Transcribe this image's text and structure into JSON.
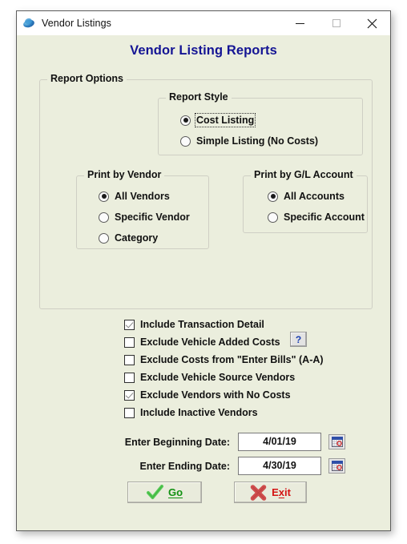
{
  "window": {
    "title": "Vendor Listings",
    "icon": "app-disc-icon",
    "controls": {
      "minimize": "minimize-icon",
      "maximize": "maximize-icon",
      "close": "close-icon"
    }
  },
  "heading": "Vendor Listing Reports",
  "colors": {
    "form_background": "#EBEEDD",
    "heading_text": "#141494",
    "go_text": "#129112",
    "exit_text": "#D41414",
    "group_border": "#CFCFC4"
  },
  "report_options": {
    "legend": "Report Options",
    "report_style": {
      "legend": "Report Style",
      "options": [
        {
          "label": "Cost Listing",
          "selected": true,
          "focused": true
        },
        {
          "label": "Simple Listing (No Costs)",
          "selected": false,
          "focused": false
        }
      ]
    },
    "print_by_vendor": {
      "legend": "Print by Vendor",
      "options": [
        {
          "label": "All Vendors",
          "selected": true
        },
        {
          "label": "Specific Vendor",
          "selected": false
        },
        {
          "label": "Category",
          "selected": false
        }
      ]
    },
    "print_by_gl_account": {
      "legend": "Print by G/L Account",
      "options": [
        {
          "label": "All Accounts",
          "selected": true
        },
        {
          "label": "Specific Account",
          "selected": false
        }
      ]
    }
  },
  "checkboxes": [
    {
      "label": "Include Transaction Detail",
      "checked": true
    },
    {
      "label": "Exclude Vehicle Added Costs",
      "checked": false
    },
    {
      "label": "Exclude Costs from \"Enter Bills\" (A-A)",
      "checked": false
    },
    {
      "label": "Exclude Vehicle Source Vendors",
      "checked": false
    },
    {
      "label": "Exclude Vendors with No Costs",
      "checked": true
    },
    {
      "label": "Include Inactive Vendors",
      "checked": false
    }
  ],
  "help_button": {
    "label": "?"
  },
  "dates": [
    {
      "label": "Enter Beginning Date:",
      "value": "4/01/19",
      "placeholder": "",
      "calendar_icon": "calendar-icon"
    },
    {
      "label": "Enter Ending Date:",
      "value": "4/30/19",
      "placeholder": "",
      "calendar_icon": "calendar-icon"
    }
  ],
  "actions": {
    "go": {
      "label": "Go",
      "icon": "green-check-icon"
    },
    "exit": {
      "label": "Exit",
      "icon": "red-x-icon"
    }
  }
}
